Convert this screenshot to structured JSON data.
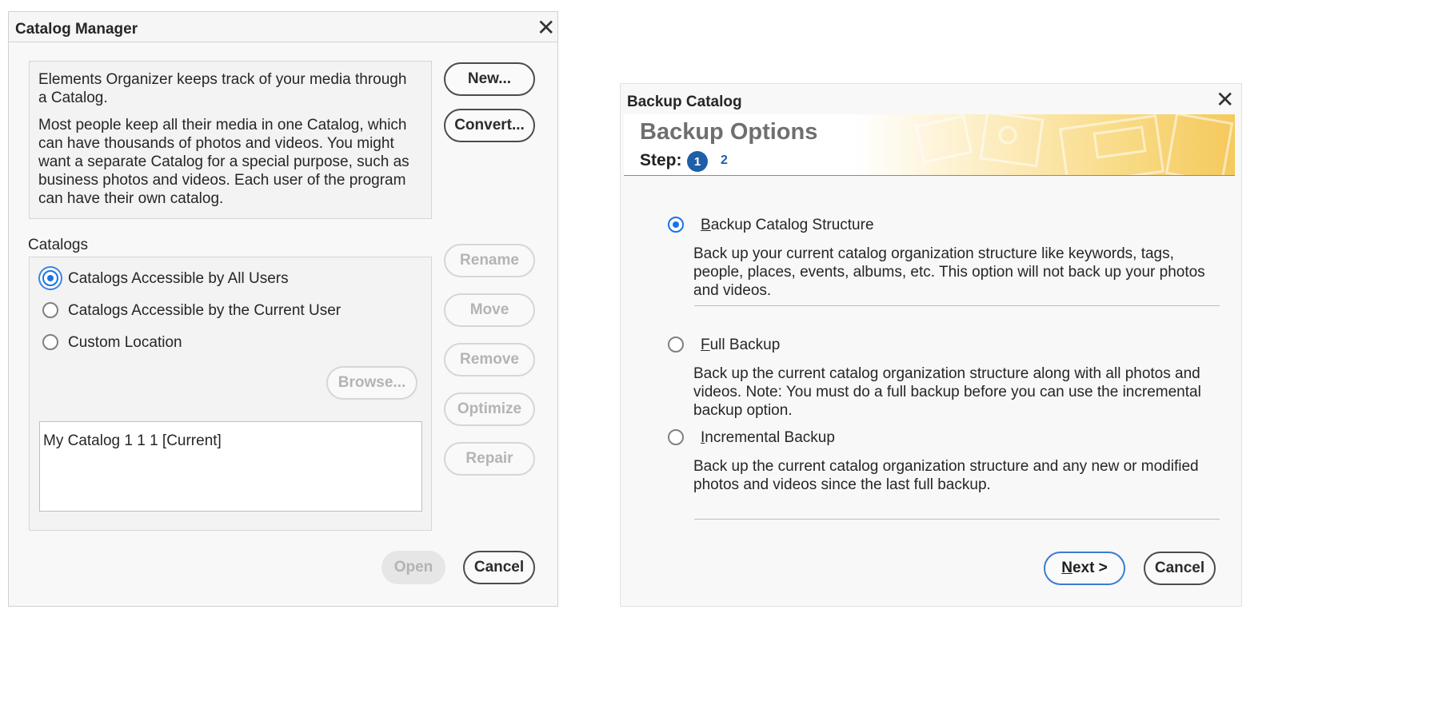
{
  "catalog_manager": {
    "title": "Catalog Manager",
    "info_p1": "Elements Organizer keeps track of your media through a Catalog.",
    "info_p2": "Most people keep all their media in one Catalog, which can have thousands of photos and videos. You might want a separate Catalog for a special purpose, such as business photos and videos. Each user of the program can have their own catalog.",
    "buttons": {
      "new": "New...",
      "convert": "Convert...",
      "rename": "Rename",
      "move": "Move",
      "remove": "Remove",
      "optimize": "Optimize",
      "repair": "Repair",
      "browse": "Browse...",
      "open": "Open",
      "cancel": "Cancel"
    },
    "catalogs_label": "Catalogs",
    "options": [
      {
        "label": "Catalogs Accessible by All Users",
        "selected": true
      },
      {
        "label": "Catalogs Accessible by the Current User",
        "selected": false
      },
      {
        "label": "Custom Location",
        "selected": false
      }
    ],
    "catalog_list": [
      "My Catalog 1 1 1 [Current]"
    ]
  },
  "backup_catalog": {
    "title": "Backup Catalog",
    "header": "Backup Options",
    "step_label": "Step:",
    "step_current": "1",
    "step_next": "2",
    "options": [
      {
        "mnemonic": "B",
        "label_rest": "ackup Catalog Structure",
        "selected": true,
        "description": "Back up your current catalog organization structure like keywords, tags, people, places, events, albums, etc. This option will not back up your photos and videos."
      },
      {
        "mnemonic": "F",
        "label_rest": "ull Backup",
        "selected": false,
        "description": "Back up the current catalog organization structure along with all photos and videos. Note: You must do a full backup before you can use the incremental backup option."
      },
      {
        "mnemonic": "I",
        "label_rest": "ncremental Backup",
        "selected": false,
        "description": "Back up the current catalog organization structure and any new or modified photos and videos since the last full backup."
      }
    ],
    "buttons": {
      "next_mnemonic": "N",
      "next_rest": "ext >",
      "cancel": "Cancel"
    }
  },
  "icons": {
    "close": "close-icon"
  },
  "colors": {
    "accent": "#1a73e8",
    "step_badge": "#1e5fa8",
    "header_text": "#6f6f6f"
  }
}
